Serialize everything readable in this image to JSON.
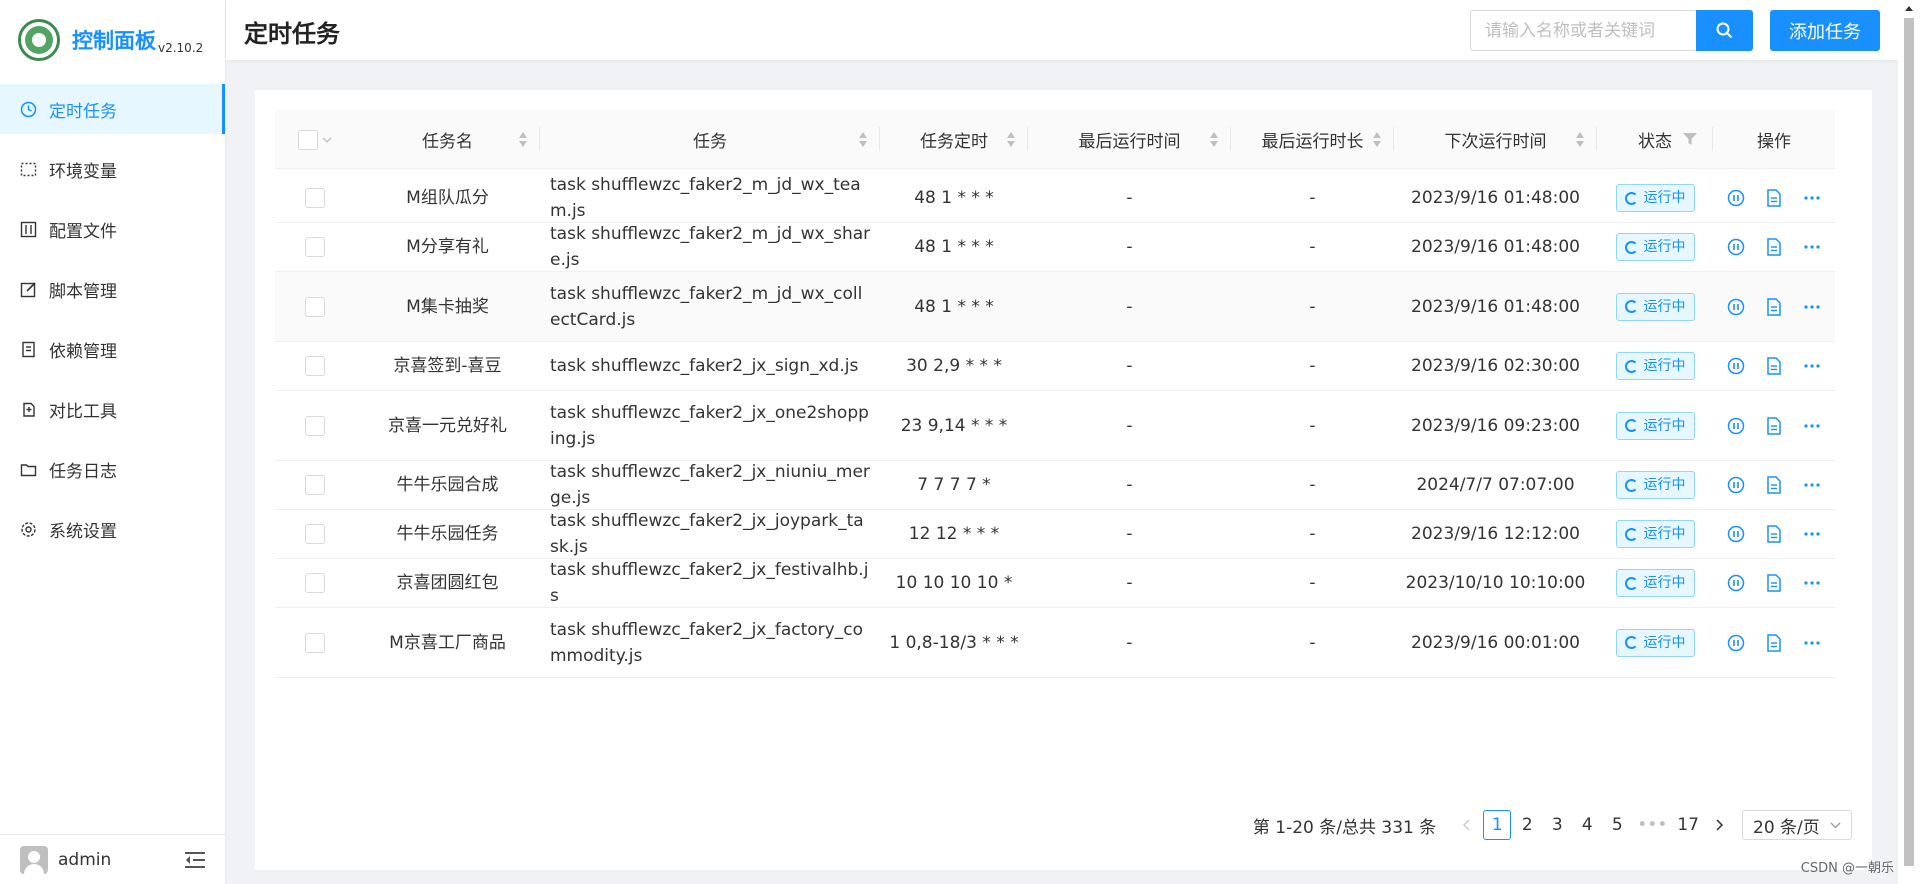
{
  "app": {
    "title": "控制面板",
    "version": "v2.10.2"
  },
  "sidebar": {
    "items": [
      {
        "label": "定时任务",
        "icon": "clock-icon",
        "active": true
      },
      {
        "label": "环境变量",
        "icon": "variable-icon",
        "active": false
      },
      {
        "label": "配置文件",
        "icon": "control-icon",
        "active": false
      },
      {
        "label": "脚本管理",
        "icon": "edit-icon",
        "active": false
      },
      {
        "label": "依赖管理",
        "icon": "container-icon",
        "active": false
      },
      {
        "label": "对比工具",
        "icon": "diff-icon",
        "active": false
      },
      {
        "label": "任务日志",
        "icon": "folder-icon",
        "active": false
      },
      {
        "label": "系统设置",
        "icon": "setting-icon",
        "active": false
      }
    ],
    "user": "admin"
  },
  "header": {
    "title": "定时任务",
    "search_placeholder": "请输入名称或者关键词",
    "add_label": "添加任务"
  },
  "table": {
    "columns": [
      "任务名",
      "任务",
      "任务定时",
      "最后运行时间",
      "最后运行时长",
      "下次运行时间",
      "状态",
      "操作"
    ],
    "rows": [
      {
        "name": "M组队瓜分",
        "command": "task shufflewzc_faker2_m_jd_wx_team.js",
        "schedule": "48 1 * * *",
        "last_run": "-",
        "duration": "-",
        "next_run": "2023/9/16 01:48:00",
        "status": "运行中"
      },
      {
        "name": "M分享有礼",
        "command": "task shufflewzc_faker2_m_jd_wx_share.js",
        "schedule": "48 1 * * *",
        "last_run": "-",
        "duration": "-",
        "next_run": "2023/9/16 01:48:00",
        "status": "运行中"
      },
      {
        "name": "M集卡抽奖",
        "command": "task shufflewzc_faker2_m_jd_wx_collectCard.js",
        "schedule": "48 1 * * *",
        "last_run": "-",
        "duration": "-",
        "next_run": "2023/9/16 01:48:00",
        "status": "运行中"
      },
      {
        "name": "京喜签到-喜豆",
        "command": "task shufflewzc_faker2_jx_sign_xd.js",
        "schedule": "30 2,9 * * *",
        "last_run": "-",
        "duration": "-",
        "next_run": "2023/9/16 02:30:00",
        "status": "运行中"
      },
      {
        "name": "京喜一元兑好礼",
        "command": "task shufflewzc_faker2_jx_one2shopping.js",
        "schedule": "23 9,14 * * *",
        "last_run": "-",
        "duration": "-",
        "next_run": "2023/9/16 09:23:00",
        "status": "运行中"
      },
      {
        "name": "牛牛乐园合成",
        "command": "task shufflewzc_faker2_jx_niuniu_merge.js",
        "schedule": "7 7 7 7 *",
        "last_run": "-",
        "duration": "-",
        "next_run": "2024/7/7 07:07:00",
        "status": "运行中"
      },
      {
        "name": "牛牛乐园任务",
        "command": "task shufflewzc_faker2_jx_joypark_task.js",
        "schedule": "12 12 * * *",
        "last_run": "-",
        "duration": "-",
        "next_run": "2023/9/16 12:12:00",
        "status": "运行中"
      },
      {
        "name": "京喜团圆红包",
        "command": "task shufflewzc_faker2_jx_festivalhb.js",
        "schedule": "10 10 10 10 *",
        "last_run": "-",
        "duration": "-",
        "next_run": "2023/10/10 10:10:00",
        "status": "运行中"
      },
      {
        "name": "M京喜工厂商品",
        "command": "task shufflewzc_faker2_jx_factory_commodity.js",
        "schedule": "1 0,8-18/3 * * *",
        "last_run": "-",
        "duration": "-",
        "next_run": "2023/9/16 00:01:00",
        "status": "运行中"
      }
    ]
  },
  "pagination": {
    "total_text": "第 1-20 条/总共 331 条",
    "pages": [
      "1",
      "2",
      "3",
      "4",
      "5",
      "•••",
      "17"
    ],
    "current": "1",
    "page_size": "20 条/页"
  },
  "watermark": "CSDN @一朝乐",
  "colors": {
    "accent": "#1890ff",
    "active_bg": "#e6f7ff"
  }
}
